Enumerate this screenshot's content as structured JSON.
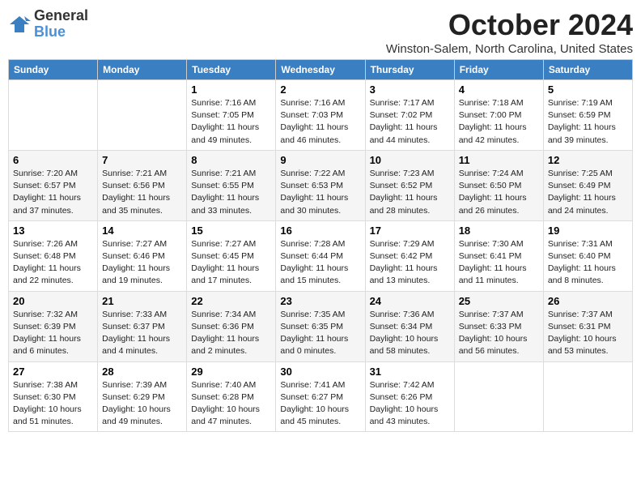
{
  "logo": {
    "text_general": "General",
    "text_blue": "Blue"
  },
  "header": {
    "title": "October 2024",
    "location": "Winston-Salem, North Carolina, United States"
  },
  "weekdays": [
    "Sunday",
    "Monday",
    "Tuesday",
    "Wednesday",
    "Thursday",
    "Friday",
    "Saturday"
  ],
  "weeks": [
    [
      {
        "day": "",
        "info": ""
      },
      {
        "day": "",
        "info": ""
      },
      {
        "day": "1",
        "info": "Sunrise: 7:16 AM\nSunset: 7:05 PM\nDaylight: 11 hours and 49 minutes."
      },
      {
        "day": "2",
        "info": "Sunrise: 7:16 AM\nSunset: 7:03 PM\nDaylight: 11 hours and 46 minutes."
      },
      {
        "day": "3",
        "info": "Sunrise: 7:17 AM\nSunset: 7:02 PM\nDaylight: 11 hours and 44 minutes."
      },
      {
        "day": "4",
        "info": "Sunrise: 7:18 AM\nSunset: 7:00 PM\nDaylight: 11 hours and 42 minutes."
      },
      {
        "day": "5",
        "info": "Sunrise: 7:19 AM\nSunset: 6:59 PM\nDaylight: 11 hours and 39 minutes."
      }
    ],
    [
      {
        "day": "6",
        "info": "Sunrise: 7:20 AM\nSunset: 6:57 PM\nDaylight: 11 hours and 37 minutes."
      },
      {
        "day": "7",
        "info": "Sunrise: 7:21 AM\nSunset: 6:56 PM\nDaylight: 11 hours and 35 minutes."
      },
      {
        "day": "8",
        "info": "Sunrise: 7:21 AM\nSunset: 6:55 PM\nDaylight: 11 hours and 33 minutes."
      },
      {
        "day": "9",
        "info": "Sunrise: 7:22 AM\nSunset: 6:53 PM\nDaylight: 11 hours and 30 minutes."
      },
      {
        "day": "10",
        "info": "Sunrise: 7:23 AM\nSunset: 6:52 PM\nDaylight: 11 hours and 28 minutes."
      },
      {
        "day": "11",
        "info": "Sunrise: 7:24 AM\nSunset: 6:50 PM\nDaylight: 11 hours and 26 minutes."
      },
      {
        "day": "12",
        "info": "Sunrise: 7:25 AM\nSunset: 6:49 PM\nDaylight: 11 hours and 24 minutes."
      }
    ],
    [
      {
        "day": "13",
        "info": "Sunrise: 7:26 AM\nSunset: 6:48 PM\nDaylight: 11 hours and 22 minutes."
      },
      {
        "day": "14",
        "info": "Sunrise: 7:27 AM\nSunset: 6:46 PM\nDaylight: 11 hours and 19 minutes."
      },
      {
        "day": "15",
        "info": "Sunrise: 7:27 AM\nSunset: 6:45 PM\nDaylight: 11 hours and 17 minutes."
      },
      {
        "day": "16",
        "info": "Sunrise: 7:28 AM\nSunset: 6:44 PM\nDaylight: 11 hours and 15 minutes."
      },
      {
        "day": "17",
        "info": "Sunrise: 7:29 AM\nSunset: 6:42 PM\nDaylight: 11 hours and 13 minutes."
      },
      {
        "day": "18",
        "info": "Sunrise: 7:30 AM\nSunset: 6:41 PM\nDaylight: 11 hours and 11 minutes."
      },
      {
        "day": "19",
        "info": "Sunrise: 7:31 AM\nSunset: 6:40 PM\nDaylight: 11 hours and 8 minutes."
      }
    ],
    [
      {
        "day": "20",
        "info": "Sunrise: 7:32 AM\nSunset: 6:39 PM\nDaylight: 11 hours and 6 minutes."
      },
      {
        "day": "21",
        "info": "Sunrise: 7:33 AM\nSunset: 6:37 PM\nDaylight: 11 hours and 4 minutes."
      },
      {
        "day": "22",
        "info": "Sunrise: 7:34 AM\nSunset: 6:36 PM\nDaylight: 11 hours and 2 minutes."
      },
      {
        "day": "23",
        "info": "Sunrise: 7:35 AM\nSunset: 6:35 PM\nDaylight: 11 hours and 0 minutes."
      },
      {
        "day": "24",
        "info": "Sunrise: 7:36 AM\nSunset: 6:34 PM\nDaylight: 10 hours and 58 minutes."
      },
      {
        "day": "25",
        "info": "Sunrise: 7:37 AM\nSunset: 6:33 PM\nDaylight: 10 hours and 56 minutes."
      },
      {
        "day": "26",
        "info": "Sunrise: 7:37 AM\nSunset: 6:31 PM\nDaylight: 10 hours and 53 minutes."
      }
    ],
    [
      {
        "day": "27",
        "info": "Sunrise: 7:38 AM\nSunset: 6:30 PM\nDaylight: 10 hours and 51 minutes."
      },
      {
        "day": "28",
        "info": "Sunrise: 7:39 AM\nSunset: 6:29 PM\nDaylight: 10 hours and 49 minutes."
      },
      {
        "day": "29",
        "info": "Sunrise: 7:40 AM\nSunset: 6:28 PM\nDaylight: 10 hours and 47 minutes."
      },
      {
        "day": "30",
        "info": "Sunrise: 7:41 AM\nSunset: 6:27 PM\nDaylight: 10 hours and 45 minutes."
      },
      {
        "day": "31",
        "info": "Sunrise: 7:42 AM\nSunset: 6:26 PM\nDaylight: 10 hours and 43 minutes."
      },
      {
        "day": "",
        "info": ""
      },
      {
        "day": "",
        "info": ""
      }
    ]
  ]
}
